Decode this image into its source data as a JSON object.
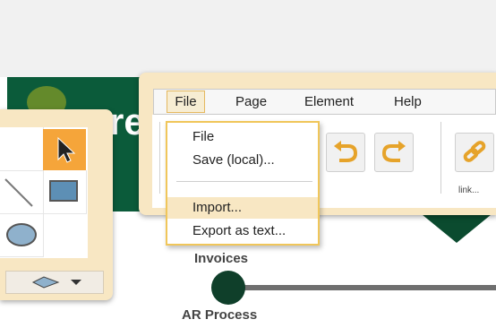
{
  "banner": {
    "text": "re"
  },
  "menubar": {
    "file": "File",
    "page": "Page",
    "element": "Element",
    "help": "Help"
  },
  "file_menu": {
    "items": [
      "File",
      "Save (local)...",
      "Import...",
      "Export as text..."
    ]
  },
  "toolbar": {
    "link_caption": "link..."
  },
  "flow": {
    "top_label": "Invoices",
    "bottom_label": "AR Process"
  },
  "colors": {
    "banner_green": "#0b5b3a",
    "panel_tan": "#f8e7c3",
    "highlight_orange": "#f5a53a"
  }
}
